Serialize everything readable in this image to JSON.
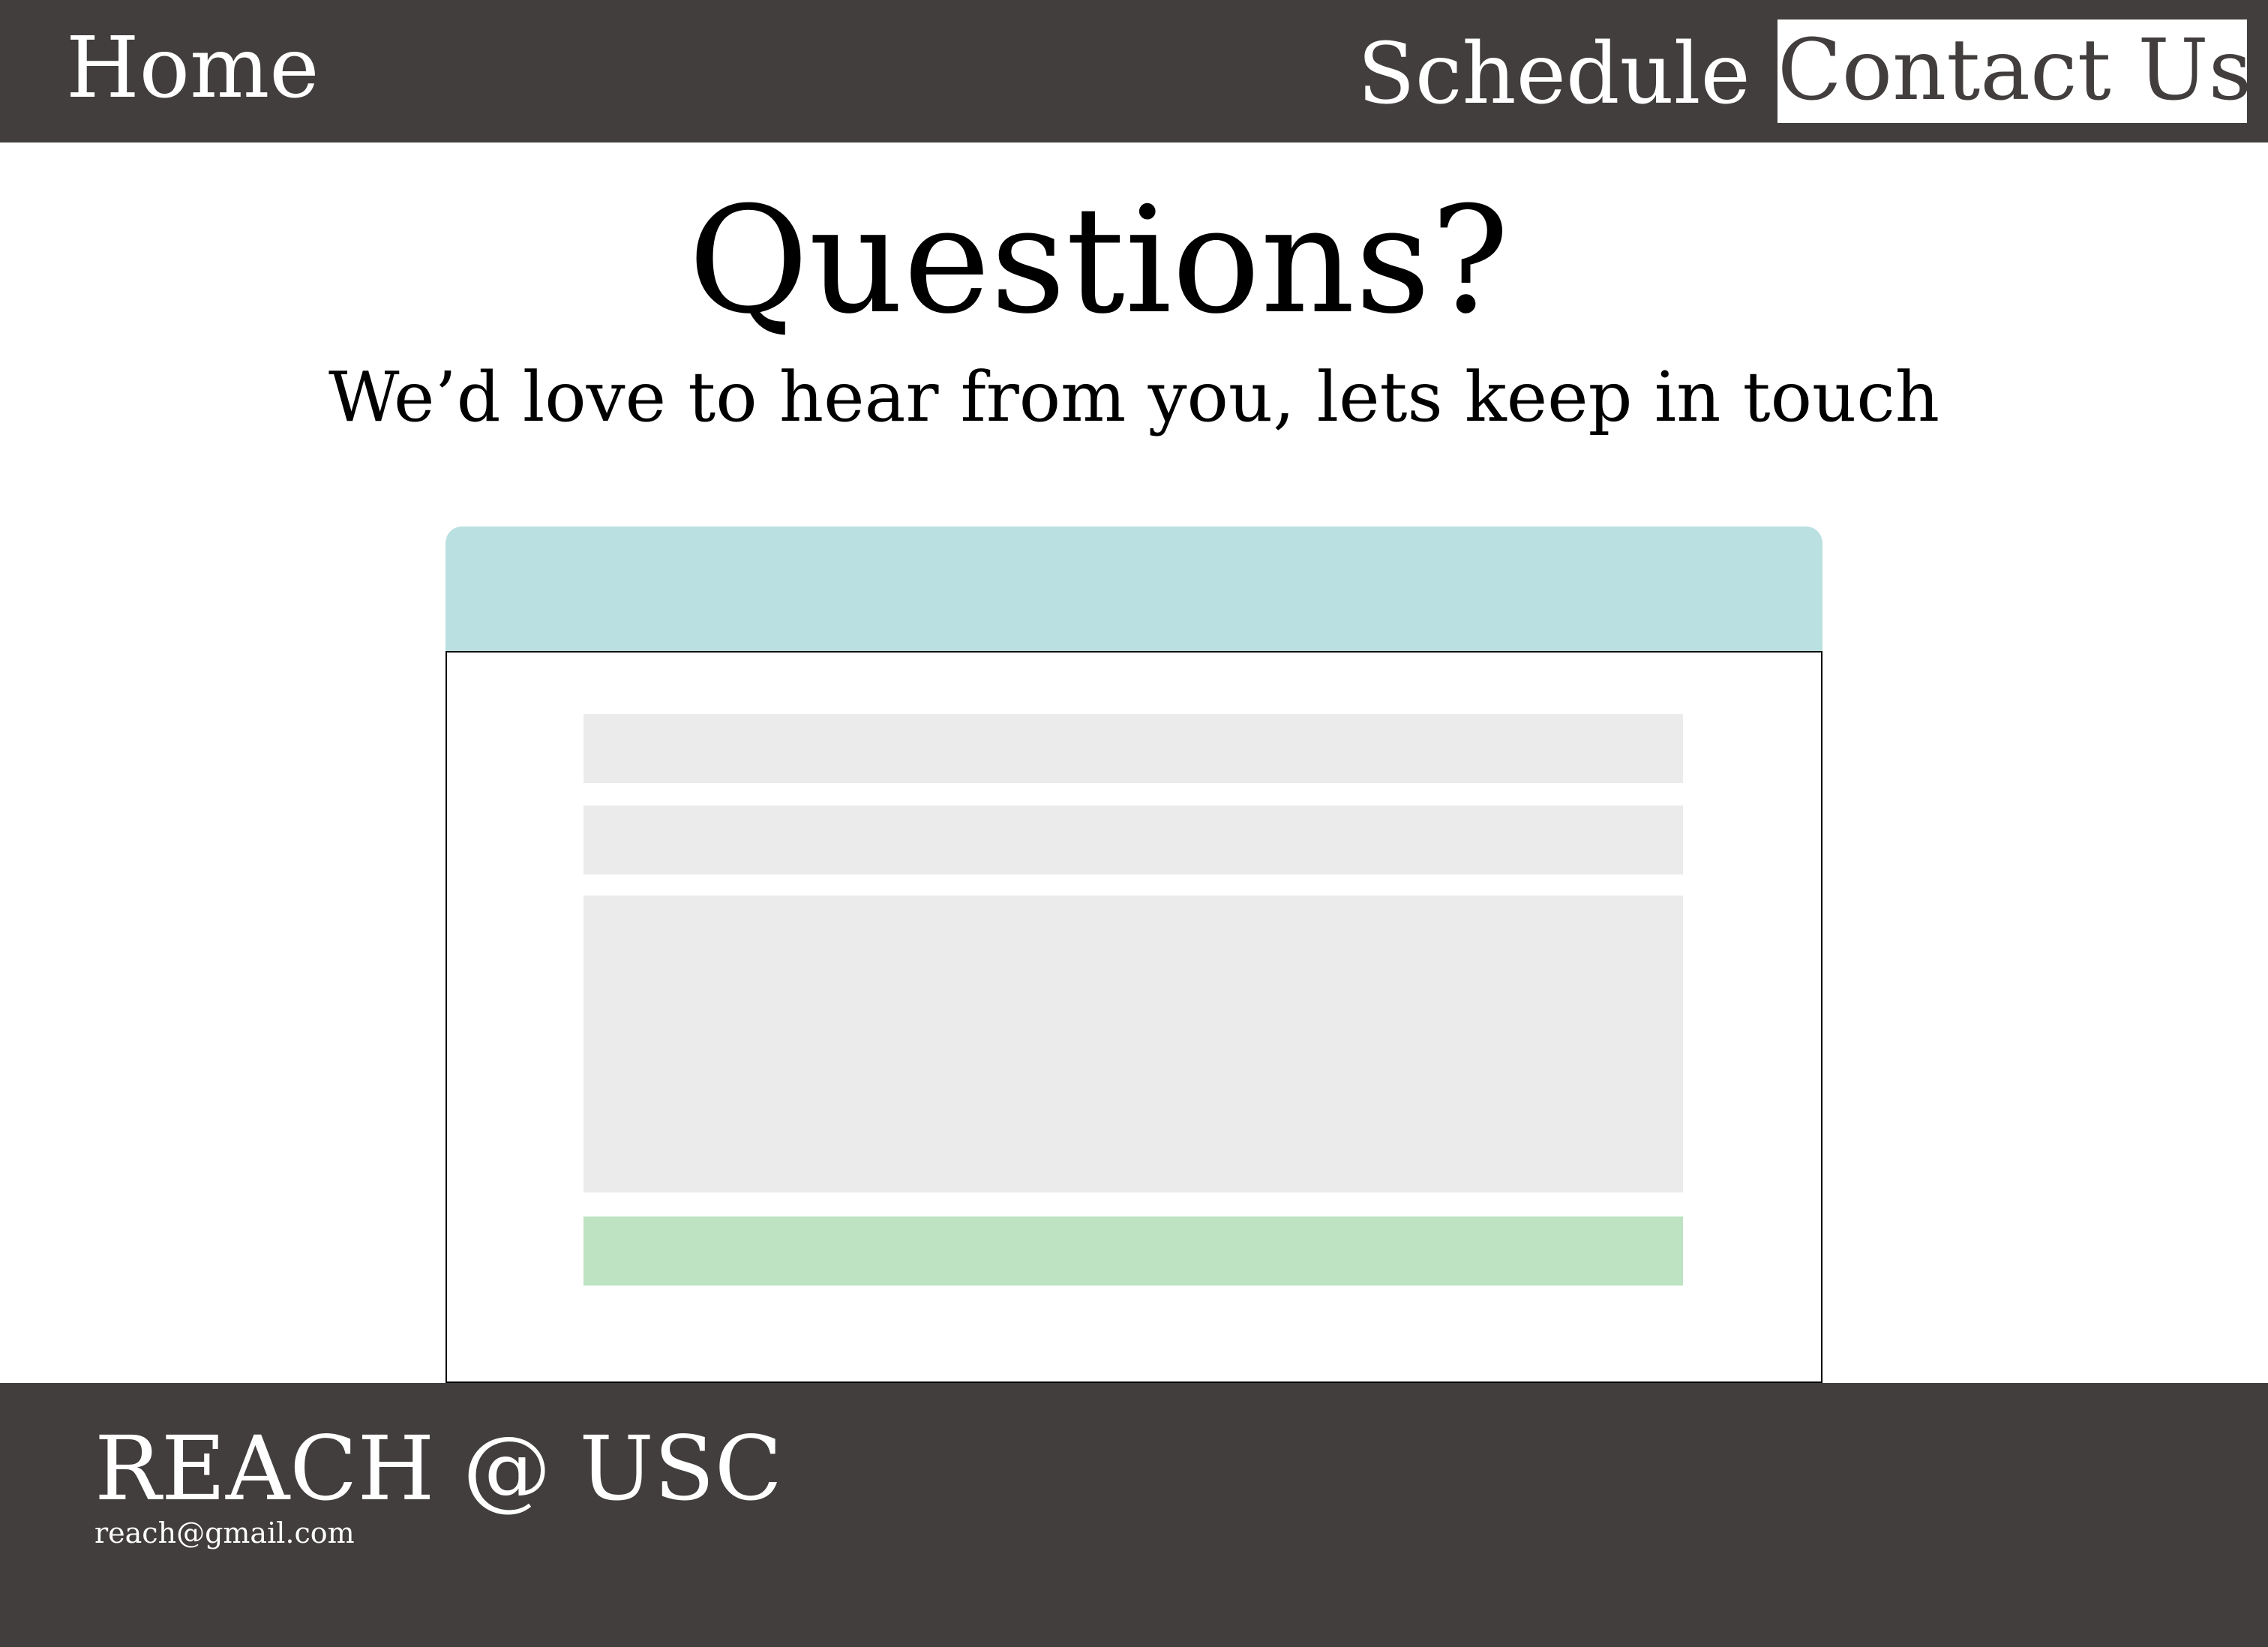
{
  "nav": {
    "home_label": "Home",
    "schedule_label": "Schedule",
    "contact_label": "Contact Us",
    "active_item": "Contact Us"
  },
  "main": {
    "title": "Questions?",
    "subtitle": "We’d love to hear from you, lets keep in touch"
  },
  "form": {
    "header_text": "",
    "field_1_value": "",
    "field_2_value": "",
    "message_value": "",
    "submit_label": ""
  },
  "footer": {
    "brand": "REACH @ USC",
    "email": "reach@gmail.com"
  },
  "colors": {
    "bar_background": "#423e3d",
    "card_header": "#bae0e1",
    "input_background": "#ebebeb",
    "submit_background": "#bde3c2"
  }
}
